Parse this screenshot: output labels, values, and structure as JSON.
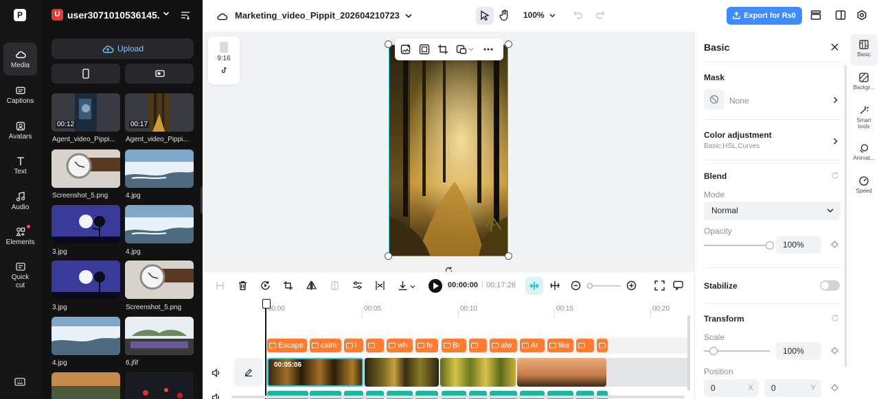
{
  "rail": {
    "items": [
      {
        "label": "Media",
        "icon": "cloud-media-icon"
      },
      {
        "label": "Captions",
        "icon": "captions-icon"
      },
      {
        "label": "Avatars",
        "icon": "avatars-icon"
      },
      {
        "label": "Text",
        "icon": "text-icon"
      },
      {
        "label": "Audio",
        "icon": "audio-icon"
      },
      {
        "label": "Elements",
        "icon": "elements-icon"
      },
      {
        "label": "Quick\ncut",
        "icon": "quick-cut-icon"
      }
    ],
    "active": "Media"
  },
  "panel": {
    "username": "user3071010536145...",
    "avatar_letter": "U",
    "upload_label": "Upload",
    "media": [
      {
        "name": "Agent_video_Pippi...",
        "duration": "00:12"
      },
      {
        "name": "Agent_video_Pippi...",
        "duration": "00:17"
      },
      {
        "name": "Screenshot_5.png"
      },
      {
        "name": "4.jpg"
      },
      {
        "name": "3.jpg"
      },
      {
        "name": "4.jpg"
      },
      {
        "name": "3.jpg"
      },
      {
        "name": "Screenshot_5.png"
      },
      {
        "name": "4.jpg"
      },
      {
        "name": "6.jfif"
      },
      {
        "name": ""
      },
      {
        "name": ""
      }
    ]
  },
  "topbar": {
    "project_name": "Marketing_video_Pippit_202604210723",
    "zoom": "100%",
    "export_label": "Export for Rs0"
  },
  "canvas": {
    "ratio_label": "9:16"
  },
  "timeline": {
    "current_time": "00:00:00",
    "total_time": "00:17:26",
    "ruler_labels": [
      "00:00",
      "00:05",
      "00:10",
      "00:15",
      "00:20"
    ],
    "clip_duration": "00:05:06",
    "captions": [
      "Escape",
      "calm",
      "l",
      "",
      "wh",
      "fe",
      "Br",
      "",
      "alw",
      "Ar",
      "like",
      "",
      ""
    ]
  },
  "properties": {
    "title": "Basic",
    "mask_label": "Mask",
    "mask_value": "None",
    "color_adjustment_label": "Color adjustment",
    "color_adjustment_sub": "Basic,HSL,Curves",
    "blend_label": "Blend",
    "mode_label": "Mode",
    "mode_value": "Normal",
    "opacity_label": "Opacity",
    "opacity_value": "100%",
    "opacity_level": 1.0,
    "stabilize_label": "Stabilize",
    "stabilize_on": false,
    "transform_label": "Transform",
    "scale_label": "Scale",
    "scale_value": "100%",
    "scale_level": 0.15,
    "position_label": "Position",
    "position_x": "0",
    "position_y": "0",
    "x_unit": "X",
    "y_unit": "Y"
  },
  "tabs": [
    {
      "label": "Basic",
      "icon": "basic-icon"
    },
    {
      "label": "Backgr...",
      "icon": "background-icon"
    },
    {
      "label": "Smart\ntools",
      "icon": "smart-tools-icon"
    },
    {
      "label": "Animat...",
      "icon": "animation-icon"
    },
    {
      "label": "Speed",
      "icon": "speed-icon"
    }
  ],
  "colors": {
    "accent": "#3f8cff",
    "selection": "#22c4d8",
    "caption": "#ff7b2f",
    "audio": "#1fb5a0"
  }
}
